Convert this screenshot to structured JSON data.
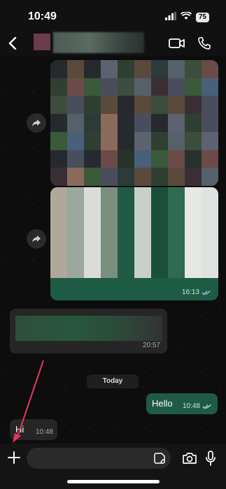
{
  "status": {
    "time": "10:49",
    "battery": "75"
  },
  "header": {
    "back_icon": "chevron-left-icon",
    "video_icon": "video-icon",
    "call_icon": "phone-icon"
  },
  "messages": {
    "img2_time": "16:13",
    "in1_time": "20:57",
    "date_divider": "Today",
    "out_text": "Hello",
    "out_time": "10:48",
    "in2_text": "Hi",
    "in2_time": "10:48"
  },
  "input_bar": {
    "placeholder": "",
    "plus_icon": "plus-icon",
    "sticker_icon": "sticker-icon",
    "camera_icon": "camera-icon",
    "mic_icon": "microphone-icon"
  },
  "colors": {
    "outgoing_bubble": "#1e5b45",
    "incoming_bubble": "#262626",
    "annotation_arrow": "#e8355a"
  }
}
